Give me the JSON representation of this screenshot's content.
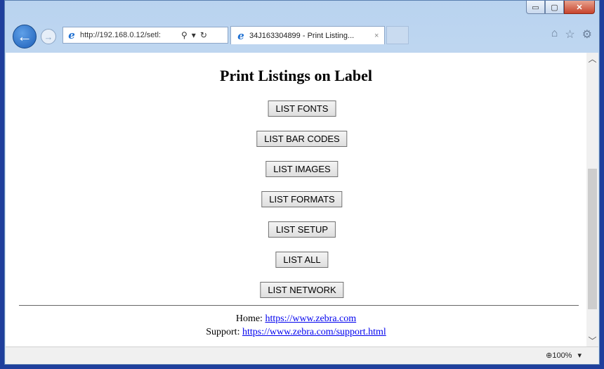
{
  "window": {
    "controls": {
      "minimize": "▭",
      "maximize": "▢",
      "close": "✕"
    }
  },
  "toolbar": {
    "address_url": "http://192.168.0.12/setl:",
    "address_host": "192.168.0.12",
    "tab_title": "34J163304899 - Print Listing...",
    "tab_close": "×",
    "icons": [
      "back-icon",
      "forward-icon",
      "search-icon",
      "refresh-icon",
      "home-icon",
      "favorites-icon",
      "settings-icon"
    ]
  },
  "page": {
    "heading": "Print Listings on Label",
    "buttons": [
      "LIST FONTS",
      "LIST BAR CODES",
      "LIST IMAGES",
      "LIST FORMATS",
      "LIST SETUP",
      "LIST ALL",
      "LIST NETWORK"
    ],
    "footer": {
      "home_label": "Home:",
      "home_link": "https://www.zebra.com",
      "support_label": "Support:",
      "support_link": "https://www.zebra.com/support.html"
    }
  },
  "statusbar": {
    "zoom": "100%"
  }
}
